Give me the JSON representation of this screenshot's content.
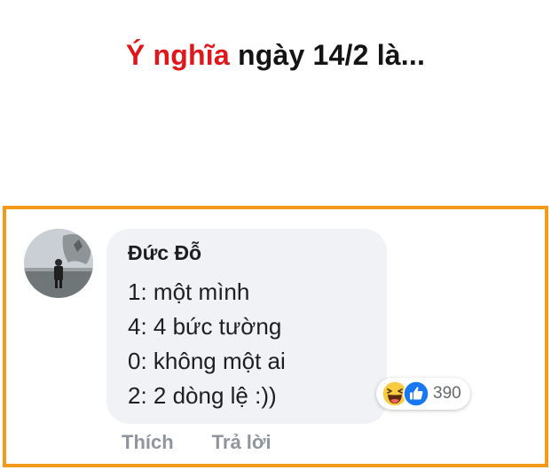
{
  "headline": {
    "accent": "Ý nghĩa",
    "rest": " ngày 14/2 là..."
  },
  "comment": {
    "author": "Đức Đỗ",
    "lines": [
      "1: một mình",
      "4: 4 bức tường",
      "0: không một ai",
      "2: 2 dòng lệ :))"
    ],
    "reactions": {
      "icons": [
        "haha-icon",
        "like-icon"
      ],
      "count": "390"
    },
    "actions": {
      "like": "Thích",
      "reply": "Trả lời"
    }
  },
  "colors": {
    "accent": "#e0161b",
    "frame": "#f39a1a",
    "bubble": "#f0f2f5",
    "like_blue": "#1877f2"
  }
}
